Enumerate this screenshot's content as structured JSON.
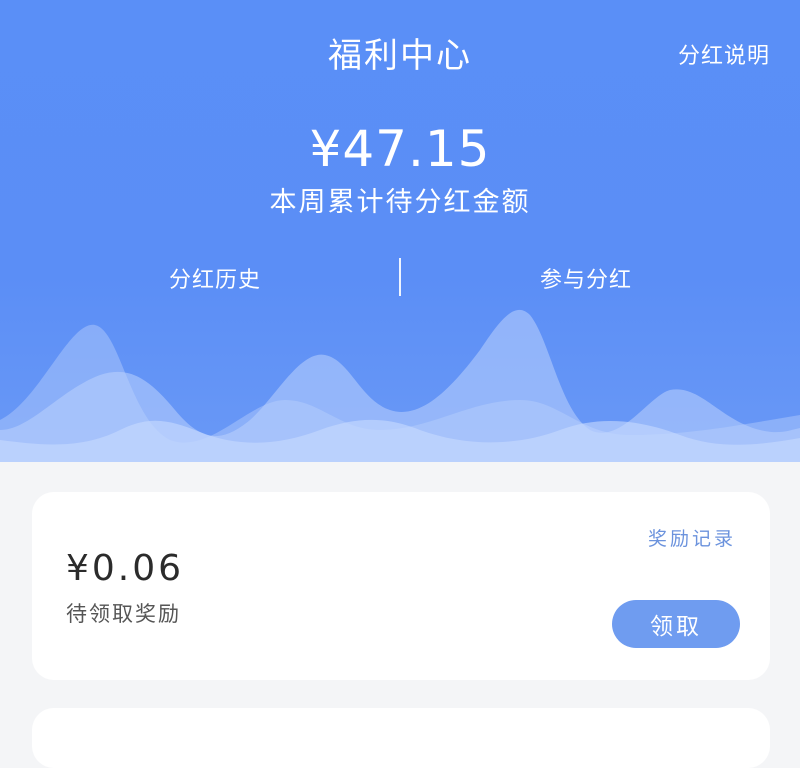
{
  "header": {
    "title": "福利中心",
    "rules_link": "分红说明"
  },
  "summary": {
    "amount": "¥47.15",
    "amount_label": "本周累计待分红金额"
  },
  "hero_actions": {
    "history": "分红历史",
    "participate": "参与分红"
  },
  "reward_card": {
    "amount": "¥0.06",
    "label": "待领取奖励",
    "history_link": "奖励记录",
    "claim_button": "领取"
  },
  "colors": {
    "hero_blue": "#5a8ff7",
    "button_blue": "#6f9cf0",
    "link_blue": "#6c93dd",
    "page_background": "#f4f5f7"
  }
}
